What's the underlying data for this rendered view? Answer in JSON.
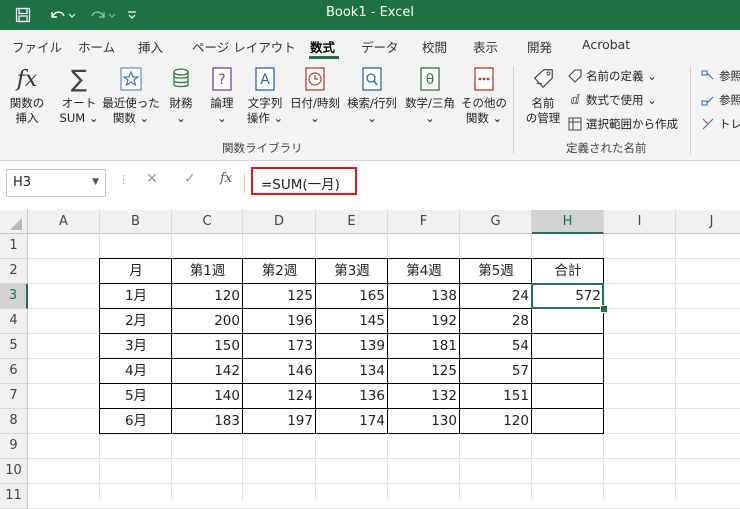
{
  "window": {
    "title": "Book1  -  Excel"
  },
  "quick_access": {
    "save_icon": "save-icon",
    "undo_icon": "undo-icon",
    "redo_icon": "redo-icon",
    "customize_icon": "customize-icon"
  },
  "menu_tabs": [
    "ファイル",
    "ホーム",
    "挿入",
    "ページ レイアウト",
    "数式",
    "データ",
    "校閲",
    "表示",
    "開発",
    "Acrobat"
  ],
  "active_tab": "数式",
  "ribbon": {
    "function_library": {
      "group_label": "関数ライブラリ",
      "buttons": [
        {
          "label1": "関数の",
          "label2": "挿入"
        },
        {
          "label1": "オート",
          "label2": "SUM ⌄"
        },
        {
          "label1": "最近使った",
          "label2": "関数 ⌄"
        },
        {
          "label1": "財務",
          "label2": "⌄"
        },
        {
          "label1": "論理",
          "label2": "⌄"
        },
        {
          "label1": "文字列",
          "label2": "操作 ⌄"
        },
        {
          "label1": "日付/時刻",
          "label2": "⌄"
        },
        {
          "label1": "検索/行列",
          "label2": "⌄"
        },
        {
          "label1": "数学/三角",
          "label2": "⌄"
        },
        {
          "label1": "その他の",
          "label2": "関数 ⌄"
        }
      ]
    },
    "defined_names": {
      "group_label": "定義された名前",
      "name_manager_label1": "名前",
      "name_manager_label2": "の管理",
      "define_name": "名前の定義  ⌄",
      "use_in_formula": "数式で使用 ⌄",
      "create_from_selection": "選択範囲から作成"
    },
    "auditing": {
      "trace_precedents": "参照",
      "trace_dependents": "参照",
      "remove_arrows": "トレ"
    }
  },
  "formula_bar": {
    "name_box": "H3",
    "cancel": "✕",
    "enter": "✓",
    "fx": "fx",
    "formula": "=SUM(一月)"
  },
  "grid": {
    "columns": [
      "A",
      "B",
      "C",
      "D",
      "E",
      "F",
      "G",
      "H",
      "I",
      "J"
    ],
    "rows": [
      "1",
      "2",
      "3",
      "4",
      "5",
      "6",
      "7",
      "8",
      "9",
      "10",
      "11"
    ],
    "selected_column": "H",
    "selected_row": "3",
    "table": {
      "headers": [
        "月",
        "第1週",
        "第2週",
        "第3週",
        "第4週",
        "第5週",
        "合計"
      ],
      "rows": [
        {
          "month": "1月",
          "values": [
            "120",
            "125",
            "165",
            "138",
            "24"
          ],
          "total": "572"
        },
        {
          "month": "2月",
          "values": [
            "200",
            "196",
            "145",
            "192",
            "28"
          ],
          "total": ""
        },
        {
          "month": "3月",
          "values": [
            "150",
            "173",
            "139",
            "181",
            "54"
          ],
          "total": ""
        },
        {
          "month": "4月",
          "values": [
            "142",
            "146",
            "134",
            "125",
            "57"
          ],
          "total": ""
        },
        {
          "month": "5月",
          "values": [
            "140",
            "124",
            "136",
            "132",
            "151"
          ],
          "total": ""
        },
        {
          "month": "6月",
          "values": [
            "183",
            "197",
            "174",
            "130",
            "120"
          ],
          "total": ""
        }
      ]
    }
  }
}
